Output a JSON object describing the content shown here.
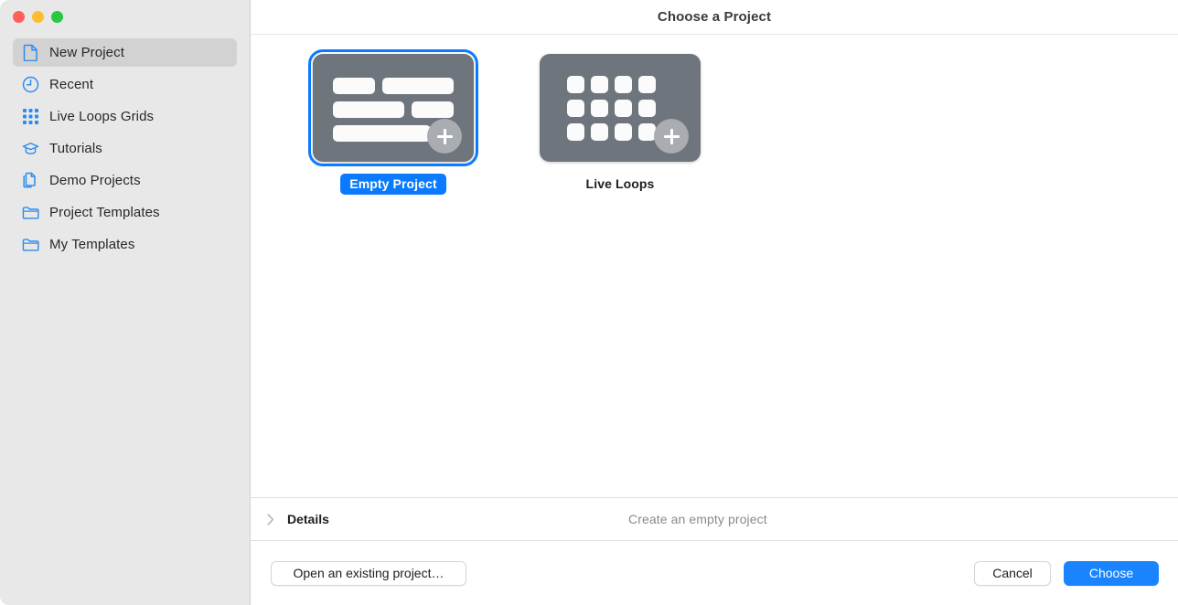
{
  "window": {
    "title": "Choose a Project",
    "traffic_lights": [
      {
        "name": "close",
        "color": "#ff5f57"
      },
      {
        "name": "minimize",
        "color": "#febc2e"
      },
      {
        "name": "zoom",
        "color": "#28c840"
      }
    ]
  },
  "sidebar": {
    "items": [
      {
        "label": "New Project",
        "icon": "document-icon",
        "selected": true
      },
      {
        "label": "Recent",
        "icon": "clock-icon",
        "selected": false
      },
      {
        "label": "Live Loops Grids",
        "icon": "grid-dots-icon",
        "selected": false
      },
      {
        "label": "Tutorials",
        "icon": "graduation-cap-icon",
        "selected": false
      },
      {
        "label": "Demo Projects",
        "icon": "documents-stack-icon",
        "selected": false
      },
      {
        "label": "Project Templates",
        "icon": "folder-icon",
        "selected": false
      },
      {
        "label": "My Templates",
        "icon": "folder-icon",
        "selected": false
      }
    ]
  },
  "main": {
    "tiles": [
      {
        "caption": "Empty Project",
        "artwork": "bars-artwork",
        "selected": true,
        "badge": "plus-icon"
      },
      {
        "caption": "Live Loops",
        "artwork": "cells-artwork",
        "selected": false,
        "badge": "plus-icon"
      }
    ]
  },
  "details": {
    "label": "Details",
    "chevron": "chevron-right-icon",
    "description": "Create an empty project",
    "expanded": false
  },
  "footer": {
    "open_existing_label": "Open an existing project…",
    "cancel_label": "Cancel",
    "choose_label": "Choose"
  },
  "colors": {
    "accent": "#0a7bff",
    "primary_button": "#1a84ff",
    "tile_background": "#6e757d",
    "sidebar_background": "#e8e8e8",
    "selected_row": "#d2d2d2"
  }
}
